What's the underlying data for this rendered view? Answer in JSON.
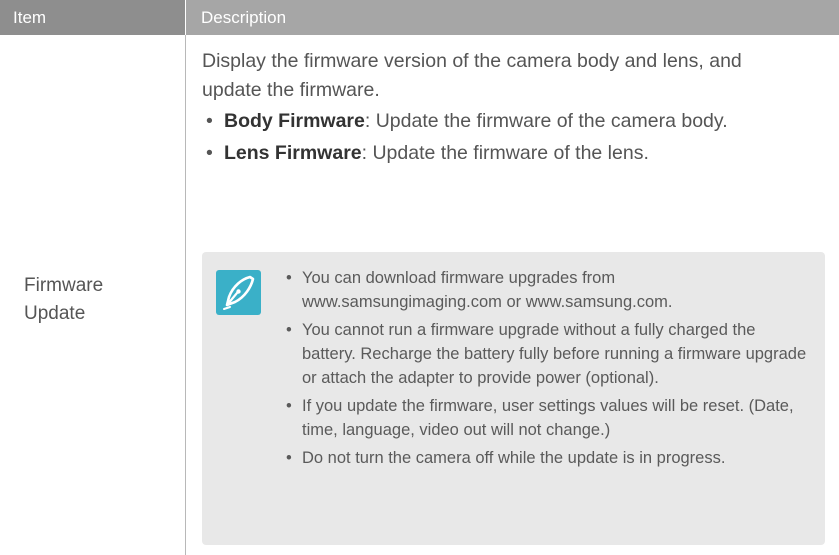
{
  "table": {
    "headers": {
      "item": "Item",
      "description": "Description"
    },
    "row": {
      "item_line1": "Firmware",
      "item_line2": "Update",
      "intro": "Display the firmware version of the camera body and lens, and update the firmware.",
      "bullets": [
        {
          "term": "Body Firmware",
          "text": ": Update the firmware of the camera body."
        },
        {
          "term": "Lens Firmware",
          "text": ": Update the firmware of the lens."
        }
      ],
      "note": {
        "icon": "note-pen-icon",
        "icon_color": "#3ab0c8",
        "items": [
          "You can download firmware upgrades from www.samsungimaging.com or www.samsung.com.",
          "You cannot run a firmware upgrade without a fully charged the battery. Recharge the battery fully before running a firmware upgrade or attach the adapter to provide power (optional).",
          "If you update the firmware, user settings values will be reset. (Date, time, language, video out will not change.)",
          "Do not turn the camera off while the update is in progress."
        ]
      }
    }
  },
  "colors": {
    "header_item_bg": "#8e8e8e",
    "header_desc_bg": "#a6a6a6",
    "note_bg": "#e8e8e8"
  }
}
